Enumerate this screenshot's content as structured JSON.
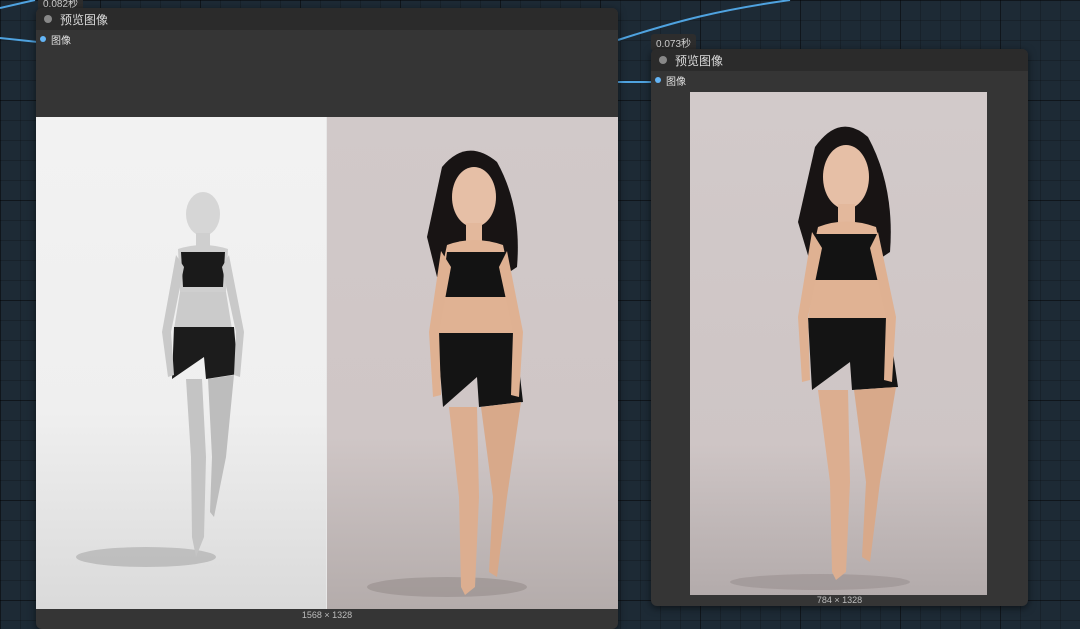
{
  "wires": {
    "color": "#4fa3e0"
  },
  "top_timing": "0.082秒",
  "node_left": {
    "title": "预览图像",
    "input_label": "图像",
    "image_size": "1568 × 1328",
    "left_panel": "3D mannequin render",
    "right_panel": "Photo of woman"
  },
  "node_right": {
    "timing": "0.073秒",
    "title": "预览图像",
    "input_label": "图像",
    "image_size": "784 × 1328"
  }
}
